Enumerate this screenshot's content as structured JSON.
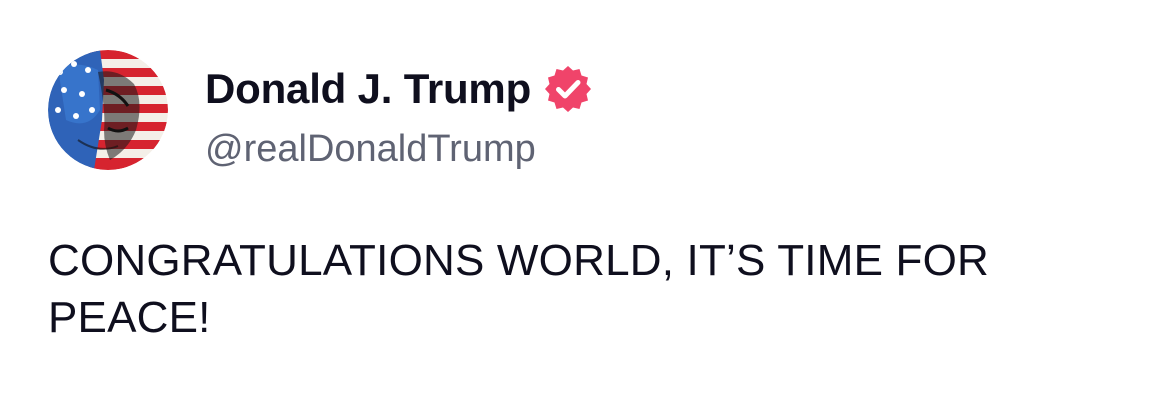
{
  "author": {
    "display_name": "Donald J. Trump",
    "handle": "@realDonaldTrump",
    "verified": true,
    "avatar_icon": "flag-portrait-avatar",
    "verified_icon": "verified-badge-icon"
  },
  "post": {
    "text": "CONGRATULATIONS WORLD, IT’S TIME FOR PEACE!"
  },
  "colors": {
    "name": "#0f0f1e",
    "handle": "#5f6373",
    "text": "#0f0f1e",
    "verified_badge": "#f0446a",
    "background": "#ffffff"
  }
}
